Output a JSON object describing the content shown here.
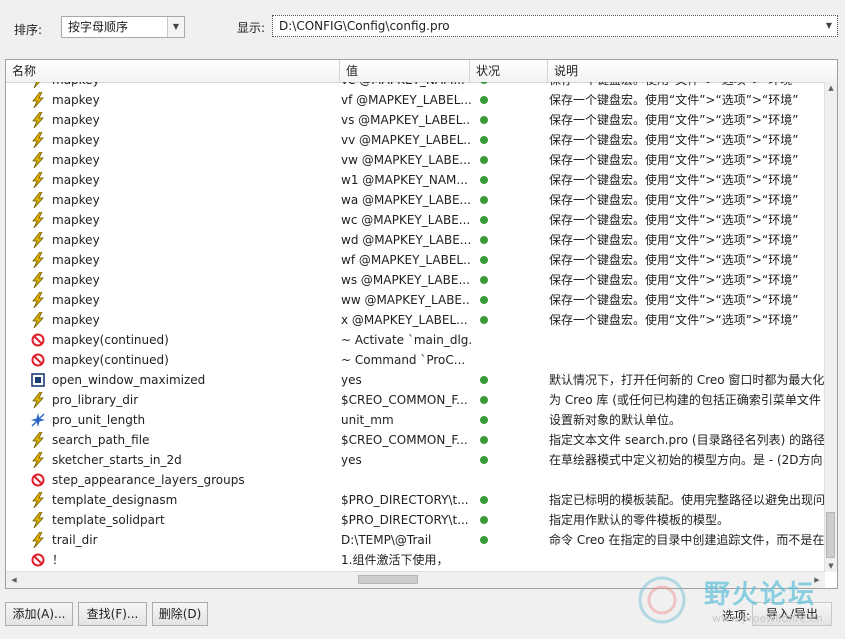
{
  "toolbar": {
    "sort_label": "排序:",
    "sort_value": "按字母顺序",
    "show_label": "显示:",
    "show_value": "D:\\CONFIG\\Config\\config.pro"
  },
  "columns": [
    "名称",
    "值",
    "状况",
    "说明"
  ],
  "rows": [
    {
      "icon": "bolt",
      "name": "mapkey",
      "value": "ve @MAPKEY_NAM...",
      "status": true,
      "desc": "保存一个键盘宏。使用“文件”>“选项”>“环境”"
    },
    {
      "icon": "bolt",
      "name": "mapkey",
      "value": "vf @MAPKEY_LABEL...",
      "status": true,
      "desc": "保存一个键盘宏。使用“文件”>“选项”>“环境”"
    },
    {
      "icon": "bolt",
      "name": "mapkey",
      "value": "vs @MAPKEY_LABEL...",
      "status": true,
      "desc": "保存一个键盘宏。使用“文件”>“选项”>“环境”"
    },
    {
      "icon": "bolt",
      "name": "mapkey",
      "value": "vv @MAPKEY_LABEL...",
      "status": true,
      "desc": "保存一个键盘宏。使用“文件”>“选项”>“环境”"
    },
    {
      "icon": "bolt",
      "name": "mapkey",
      "value": "vw @MAPKEY_LABE...",
      "status": true,
      "desc": "保存一个键盘宏。使用“文件”>“选项”>“环境”"
    },
    {
      "icon": "bolt",
      "name": "mapkey",
      "value": "w1 @MAPKEY_NAM...",
      "status": true,
      "desc": "保存一个键盘宏。使用“文件”>“选项”>“环境”"
    },
    {
      "icon": "bolt",
      "name": "mapkey",
      "value": "wa @MAPKEY_LABE...",
      "status": true,
      "desc": "保存一个键盘宏。使用“文件”>“选项”>“环境”"
    },
    {
      "icon": "bolt",
      "name": "mapkey",
      "value": "wc @MAPKEY_LABE...",
      "status": true,
      "desc": "保存一个键盘宏。使用“文件”>“选项”>“环境”"
    },
    {
      "icon": "bolt",
      "name": "mapkey",
      "value": "wd @MAPKEY_LABE...",
      "status": true,
      "desc": "保存一个键盘宏。使用“文件”>“选项”>“环境”"
    },
    {
      "icon": "bolt",
      "name": "mapkey",
      "value": "wf @MAPKEY_LABEL...",
      "status": true,
      "desc": "保存一个键盘宏。使用“文件”>“选项”>“环境”"
    },
    {
      "icon": "bolt",
      "name": "mapkey",
      "value": "ws @MAPKEY_LABE...",
      "status": true,
      "desc": "保存一个键盘宏。使用“文件”>“选项”>“环境”"
    },
    {
      "icon": "bolt",
      "name": "mapkey",
      "value": "ww @MAPKEY_LABE...",
      "status": true,
      "desc": "保存一个键盘宏。使用“文件”>“选项”>“环境”"
    },
    {
      "icon": "bolt",
      "name": "mapkey",
      "value": "x @MAPKEY_LABEL...",
      "status": true,
      "desc": "保存一个键盘宏。使用“文件”>“选项”>“环境”"
    },
    {
      "icon": "forbidden",
      "name": "mapkey(continued)",
      "value": "~ Activate `main_dlg...",
      "status": false,
      "desc": ""
    },
    {
      "icon": "forbidden",
      "name": "mapkey(continued)",
      "value": "~ Command `ProC...",
      "status": false,
      "desc": ""
    },
    {
      "icon": "window",
      "name": "open_window_maximized",
      "value": "yes",
      "status": true,
      "desc": "默认情况下，打开任何新的 Creo 窗口时都为最大化"
    },
    {
      "icon": "bolt",
      "name": "pro_library_dir",
      "value": "$CREO_COMMON_F...",
      "status": true,
      "desc": "为 Creo 库 (或任何已构建的包括正确索引菜单文件"
    },
    {
      "icon": "star",
      "name": "pro_unit_length",
      "value": "unit_mm",
      "status": true,
      "desc": "设置新对象的默认单位。"
    },
    {
      "icon": "bolt",
      "name": "search_path_file",
      "value": "$CREO_COMMON_F...",
      "status": true,
      "desc": "指定文本文件 search.pro (目录路径名列表) 的路径"
    },
    {
      "icon": "bolt",
      "name": "sketcher_starts_in_2d",
      "value": "yes",
      "status": true,
      "desc": "在草绘器模式中定义初始的模型方向。是 - (2D方向"
    },
    {
      "icon": "forbidden",
      "name": "step_appearance_layers_groups",
      "value": "",
      "status": false,
      "desc": ""
    },
    {
      "icon": "bolt",
      "name": "template_designasm",
      "value": "$PRO_DIRECTORY\\t...",
      "status": true,
      "desc": "指定已标明的模板装配。使用完整路径以避免出现问"
    },
    {
      "icon": "bolt",
      "name": "template_solidpart",
      "value": "$PRO_DIRECTORY\\t...",
      "status": true,
      "desc": "指定用作默认的零件模板的模型。"
    },
    {
      "icon": "bolt",
      "name": "trail_dir",
      "value": "D:\\TEMP\\@Trail",
      "status": true,
      "desc": "命令 Creo 在指定的目录中创建追踪文件，而不是在"
    },
    {
      "icon": "forbidden",
      "name": "！",
      "value": "1.组件激活下使用，",
      "status": false,
      "desc": ""
    }
  ],
  "buttons": {
    "add": "添加(A)...",
    "find": "查找(F)...",
    "delete": "删除(D)"
  },
  "options": {
    "label": "选项:",
    "value": "导入/导出"
  },
  "watermark": {
    "text": "野火论坛",
    "url": "www.proewildfire.cn"
  },
  "colors": {
    "status_ok": "#3a9a3a",
    "forbidden": "#e0202a",
    "bolt": "#e0b000"
  }
}
